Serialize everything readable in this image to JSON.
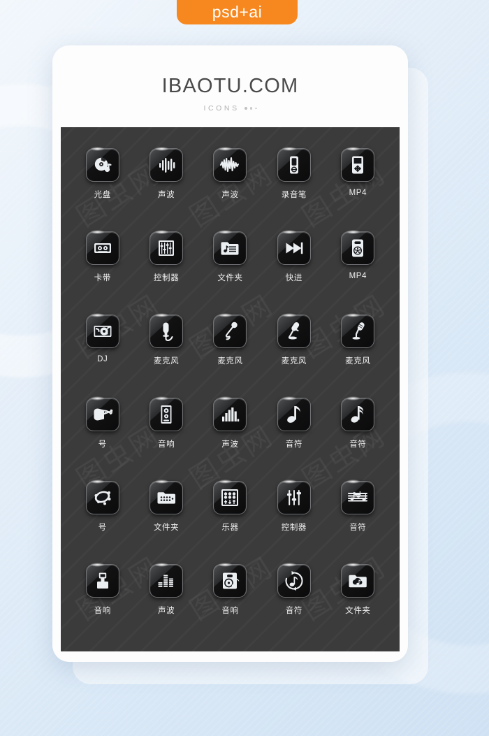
{
  "badge": {
    "label": "psd+ai",
    "color": "#f6881f"
  },
  "card": {
    "title": "IBAOTU.COM",
    "subtitle": "ICONS"
  },
  "panel": {
    "background": "#3b3b3b",
    "watermark": "图虫网",
    "columns": 5,
    "rows": 6,
    "icons": [
      {
        "label": "光盘",
        "icon": "cd-disc-icon"
      },
      {
        "label": "声波",
        "icon": "sound-wave-bars-icon"
      },
      {
        "label": "声波",
        "icon": "sound-waveform-icon"
      },
      {
        "label": "录音笔",
        "icon": "voice-recorder-icon"
      },
      {
        "label": "MP4",
        "icon": "mp4-player-icon"
      },
      {
        "label": "卡带",
        "icon": "cassette-tape-icon"
      },
      {
        "label": "控制器",
        "icon": "equalizer-sliders-icon"
      },
      {
        "label": "文件夹",
        "icon": "music-folder-icon"
      },
      {
        "label": "快进",
        "icon": "fast-forward-icon"
      },
      {
        "label": "MP4",
        "icon": "mp4-player-alt-icon"
      },
      {
        "label": "DJ",
        "icon": "dj-turntable-icon"
      },
      {
        "label": "麦克风",
        "icon": "microphone-handheld-icon"
      },
      {
        "label": "麦克风",
        "icon": "microphone-curved-icon"
      },
      {
        "label": "麦克风",
        "icon": "microphone-stand-icon"
      },
      {
        "label": "麦克风",
        "icon": "microphone-desk-icon"
      },
      {
        "label": "号",
        "icon": "horn-megaphone-icon"
      },
      {
        "label": "音响",
        "icon": "speaker-tower-icon"
      },
      {
        "label": "声波",
        "icon": "bar-levels-icon"
      },
      {
        "label": "音符",
        "icon": "eighth-note-icon"
      },
      {
        "label": "音符",
        "icon": "sixteenth-note-icon"
      },
      {
        "label": "号",
        "icon": "tambourine-icon"
      },
      {
        "label": "文件夹",
        "icon": "folder-dots-icon"
      },
      {
        "label": "乐器",
        "icon": "instrument-panel-icon"
      },
      {
        "label": "控制器",
        "icon": "fader-controller-icon"
      },
      {
        "label": "音符",
        "icon": "music-staff-icon"
      },
      {
        "label": "音响",
        "icon": "usb-speaker-icon"
      },
      {
        "label": "声波",
        "icon": "equalizer-blocks-icon"
      },
      {
        "label": "音响",
        "icon": "speaker-note-icon"
      },
      {
        "label": "音符",
        "icon": "note-refresh-icon"
      },
      {
        "label": "文件夹",
        "icon": "cloud-music-folder-icon"
      }
    ]
  }
}
